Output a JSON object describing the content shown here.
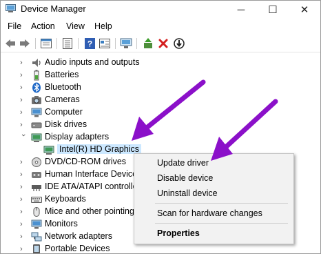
{
  "window": {
    "title": "Device Manager",
    "buttons": {
      "minimize": "─",
      "maximize": "☐",
      "close": "✕"
    }
  },
  "menu": [
    "File",
    "Action",
    "View",
    "Help"
  ],
  "toolbar": [
    "back-icon",
    "forward-icon",
    "properties-sheet-icon",
    "list-view-icon",
    "help-icon",
    "view-icon",
    "computer-scan-icon",
    "add-driver-icon",
    "uninstall-icon",
    "update-icon"
  ],
  "tree": {
    "items": [
      {
        "label": "Audio inputs and outputs",
        "icon": "speaker-icon",
        "expanded": false
      },
      {
        "label": "Batteries",
        "icon": "battery-icon",
        "expanded": false
      },
      {
        "label": "Bluetooth",
        "icon": "bluetooth-icon",
        "expanded": false
      },
      {
        "label": "Cameras",
        "icon": "camera-icon",
        "expanded": false
      },
      {
        "label": "Computer",
        "icon": "computer-icon",
        "expanded": false
      },
      {
        "label": "Disk drives",
        "icon": "disk-icon",
        "expanded": false
      },
      {
        "label": "Display adapters",
        "icon": "display-icon",
        "expanded": true
      },
      {
        "label": "Intel(R) HD Graphics",
        "icon": "display-icon",
        "child": true,
        "selected": true
      },
      {
        "label": "DVD/CD-ROM drives",
        "icon": "dvd-icon",
        "expanded": false
      },
      {
        "label": "Human Interface Device",
        "icon": "hid-icon",
        "expanded": false
      },
      {
        "label": "IDE ATA/ATAPI controller",
        "icon": "ide-icon",
        "expanded": false
      },
      {
        "label": "Keyboards",
        "icon": "keyboard-icon",
        "expanded": false
      },
      {
        "label": "Mice and other pointing",
        "icon": "mouse-icon",
        "expanded": false
      },
      {
        "label": "Monitors",
        "icon": "monitor-icon",
        "expanded": false
      },
      {
        "label": "Network adapters",
        "icon": "network-icon",
        "expanded": false
      },
      {
        "label": "Portable Devices",
        "icon": "portable-icon",
        "expanded": false
      }
    ]
  },
  "context_menu": {
    "items": [
      {
        "label": "Update driver",
        "bold": false
      },
      {
        "label": "Disable device",
        "bold": false
      },
      {
        "label": "Uninstall device",
        "bold": false
      },
      {
        "separator": true
      },
      {
        "label": "Scan for hardware changes",
        "bold": false
      },
      {
        "separator": true
      },
      {
        "label": "Properties",
        "bold": true
      }
    ]
  },
  "annotations": {
    "arrow_color": "#8b10c9"
  },
  "colors": {
    "selection": "#cce8ff",
    "menu_bg": "#f2f2f2"
  }
}
